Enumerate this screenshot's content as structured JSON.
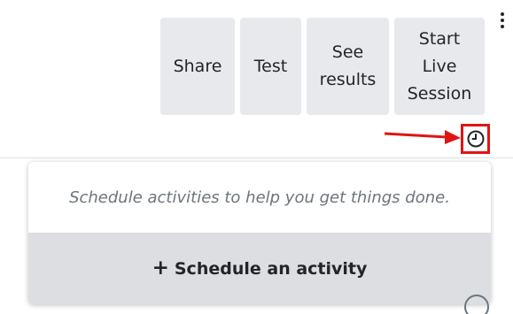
{
  "toolbar": {
    "share": "Share",
    "test": "Test",
    "see_results": "See\nresults",
    "start_live": "Start\nLive\nSession"
  },
  "icons": {
    "menu": "vertical-ellipsis-icon",
    "clock": "clock-icon",
    "annotation": "red-arrow-icon",
    "plus": "plus-icon"
  },
  "activity_popover": {
    "message": "Schedule activities to help you get things done.",
    "button_label": "Schedule an activity",
    "plus_glyph": "+"
  },
  "colors": {
    "button_bg": "#e7e9ed",
    "highlight": "#e11414",
    "muted_text": "#6c757d"
  }
}
